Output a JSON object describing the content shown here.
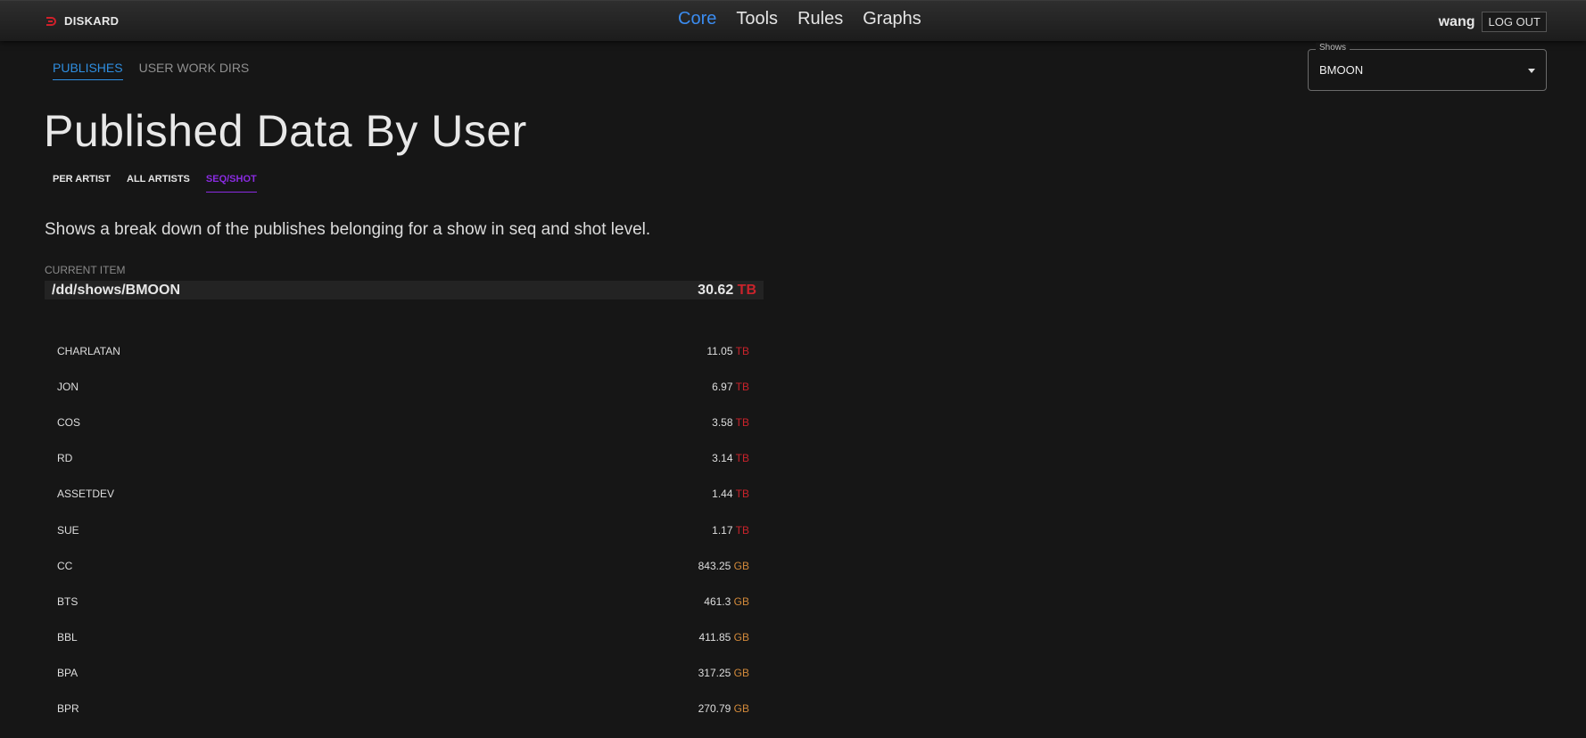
{
  "app": {
    "brand": "DISKARD"
  },
  "nav": [
    {
      "label": "Core",
      "active": true
    },
    {
      "label": "Tools",
      "active": false
    },
    {
      "label": "Rules",
      "active": false
    },
    {
      "label": "Graphs",
      "active": false
    }
  ],
  "user": {
    "name": "wang",
    "logout_label": "LOG OUT"
  },
  "subtabs": [
    {
      "label": "PUBLISHES",
      "active": true
    },
    {
      "label": "USER WORK DIRS",
      "active": false
    }
  ],
  "shows_select": {
    "legend": "Shows",
    "value": "BMOON"
  },
  "page_title": "Published Data By User",
  "view_tabs": [
    {
      "label": "PER ARTIST",
      "active": false
    },
    {
      "label": "ALL ARTISTS",
      "active": false
    },
    {
      "label": "SEQ/SHOT",
      "active": true
    }
  ],
  "description": "Shows a break down of the publishes belonging for a show in seq and shot level.",
  "current_item": {
    "label": "CURRENT ITEM",
    "path": "/dd/shows/BMOON",
    "size": "30.62",
    "unit": "TB"
  },
  "colors": {
    "accent": "#2f8ee0",
    "nav_active": "#3b8cf0",
    "tab_purple": "#8a2be2",
    "tb": "#c9232b",
    "gb": "#d2893a"
  },
  "rows": [
    {
      "name": "CHARLATAN",
      "size": "11.05",
      "unit": "TB"
    },
    {
      "name": "JON",
      "size": "6.97",
      "unit": "TB"
    },
    {
      "name": "COS",
      "size": "3.58",
      "unit": "TB"
    },
    {
      "name": "RD",
      "size": "3.14",
      "unit": "TB"
    },
    {
      "name": "ASSETDEV",
      "size": "1.44",
      "unit": "TB"
    },
    {
      "name": "SUE",
      "size": "1.17",
      "unit": "TB"
    },
    {
      "name": "CC",
      "size": "843.25",
      "unit": "GB"
    },
    {
      "name": "BTS",
      "size": "461.3",
      "unit": "GB"
    },
    {
      "name": "BBL",
      "size": "411.85",
      "unit": "GB"
    },
    {
      "name": "BPA",
      "size": "317.25",
      "unit": "GB"
    },
    {
      "name": "BPR",
      "size": "270.79",
      "unit": "GB"
    }
  ]
}
